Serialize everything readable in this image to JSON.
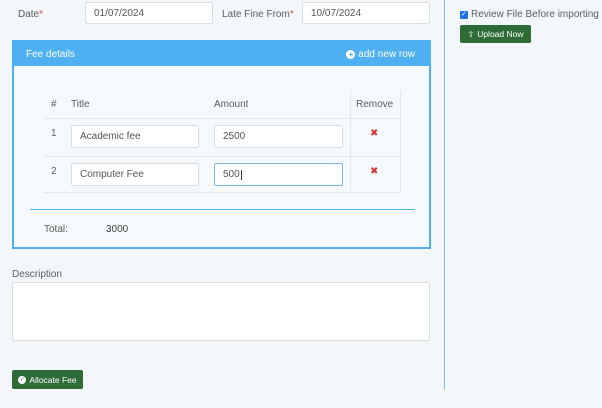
{
  "form": {
    "date_label": "Date",
    "date_value": "01/07/2024",
    "late_fine_label": "Late Fine From",
    "late_fine_value": "10/07/2024",
    "required_mark": "*"
  },
  "fee_panel": {
    "title": "Fee details",
    "add_row_label": "add new row",
    "columns": [
      "#",
      "Title",
      "Amount",
      "Remove"
    ],
    "rows": [
      {
        "index": "1",
        "title": "Academic fee",
        "amount": "2500"
      },
      {
        "index": "2",
        "title": "Computer Fee",
        "amount": "500"
      }
    ],
    "total_label": "Total:",
    "total_value": "3000"
  },
  "description": {
    "label": "Description",
    "value": ""
  },
  "actions": {
    "allocate_label": "Allocate Fee"
  },
  "sidebar": {
    "review_label": "Review File Before importing",
    "review_checked": true,
    "upload_label": "Upload Now"
  },
  "colors": {
    "accent": "#4eb0f0",
    "button_green": "#2e6b36",
    "remove_red": "#d43a3a"
  }
}
